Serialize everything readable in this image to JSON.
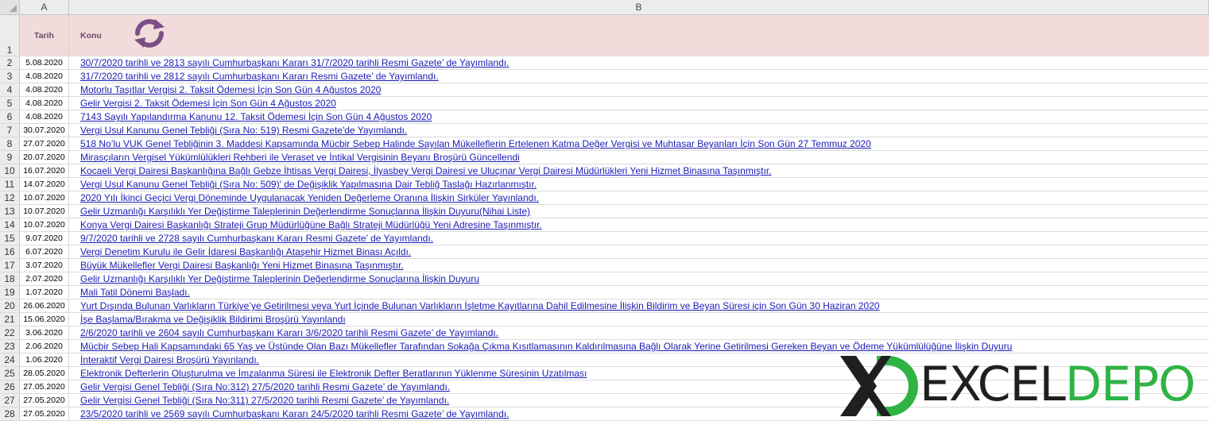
{
  "columns": {
    "a": "A",
    "b": "B"
  },
  "header": {
    "row_num": "1",
    "col_a": "Tarih",
    "col_b": "Konu"
  },
  "icons": {
    "refresh": "refresh-icon",
    "select_all": "select-all-triangle"
  },
  "colors": {
    "header_fill": "#f2dcdb",
    "link": "#1c1cb6",
    "refresh_icon": "#7b4e86",
    "logo_green": "#2fb344"
  },
  "logo": {
    "part1": "EXCEL",
    "part2": "DEPO"
  },
  "rows": [
    {
      "n": "2",
      "date": "5.08.2020",
      "title": "30/7/2020 tarihli ve 2813 sayılı Cumhurbaşkanı Kararı 31/7/2020 tarihli Resmi Gazete’ de Yayımlandı."
    },
    {
      "n": "3",
      "date": "4.08.2020",
      "title": "31/7/2020 tarihli ve 2812 sayılı Cumhurbaşkanı Kararı Resmi Gazete’ de Yayımlandı."
    },
    {
      "n": "4",
      "date": "4.08.2020",
      "title": "Motorlu Taşıtlar Vergisi 2. Taksit Ödemesi İçin Son Gün 4 Ağustos 2020"
    },
    {
      "n": "5",
      "date": "4.08.2020",
      "title": "Gelir Vergisi 2. Taksit Ödemesi İçin Son Gün 4 Ağustos 2020"
    },
    {
      "n": "6",
      "date": "4.08.2020",
      "title": "7143 Sayılı Yapılandırma Kanunu 12. Taksit Ödemesi İçin Son Gün 4 Ağustos 2020"
    },
    {
      "n": "7",
      "date": "30.07.2020",
      "title": "Vergi Usul Kanunu Genel Tebliği (Sıra No: 519) Resmi Gazete'de Yayımlandı."
    },
    {
      "n": "8",
      "date": "27.07.2020",
      "title": "518 No’lu VUK Genel Tebliğinin 3. Maddesi Kapsamında Mücbir Sebep Halinde Sayılan Mükelleflerin Ertelenen Katma Değer Vergisi ve Muhtasar Beyanları İçin Son Gün 27 Temmuz 2020"
    },
    {
      "n": "9",
      "date": "20.07.2020",
      "title": "Mirasçıların Vergisel Yükümlülükleri Rehberi ile Veraset ve İntikal Vergisinin Beyanı Broşürü Güncellendi"
    },
    {
      "n": "10",
      "date": "16.07.2020",
      "title": "Kocaeli Vergi Dairesi Başkanlığına Bağlı Gebze İhtisas Vergi Dairesi, İlyasbey Vergi Dairesi ve Uluçınar Vergi Dairesi Müdürlükleri Yeni Hizmet Binasına Taşınmıştır."
    },
    {
      "n": "11",
      "date": "14.07.2020",
      "title": "Vergi Usul Kanunu Genel Tebliği (Sıra No: 509)' de Değişiklik Yapılmasına Dair Tebliğ Taslağı Hazırlanmıştır."
    },
    {
      "n": "12",
      "date": "10.07.2020",
      "title": "2020 Yılı İkinci Geçici Vergi Döneminde Uygulanacak Yeniden Değerleme Oranına İlişkin Sirküler Yayınlandı."
    },
    {
      "n": "13",
      "date": "10.07.2020",
      "title": "Gelir Uzmanlığı Karşılıklı Yer Değiştirme Taleplerinin Değerlendirme Sonuçlarına İlişkin Duyuru(Nihai Liste)"
    },
    {
      "n": "14",
      "date": "10.07.2020",
      "title": "Konya Vergi Dairesi Başkanlığı Strateji Grup Müdürlüğüne Bağlı Strateji Müdürlüğü Yeni Adresine Taşınmıştır."
    },
    {
      "n": "15",
      "date": "9.07.2020",
      "title": "9/7/2020 tarihli ve 2728 sayılı Cumhurbaşkanı Kararı Resmi Gazete’ de Yayımlandı."
    },
    {
      "n": "16",
      "date": "6.07.2020",
      "title": "Vergi Denetim Kurulu ile Gelir İdaresi Başkanlığı Ataşehir Hizmet Binası Açıldı."
    },
    {
      "n": "17",
      "date": "3.07.2020",
      "title": "Büyük Mükellefler Vergi Dairesi Başkanlığı Yeni Hizmet Binasına Taşınmıştır."
    },
    {
      "n": "18",
      "date": "2.07.2020",
      "title": "Gelir Uzmanlığı Karşılıklı Yer Değiştirme Taleplerinin Değerlendirme Sonuçlarına İlişkin Duyuru"
    },
    {
      "n": "19",
      "date": "1.07.2020",
      "title": "Mali Tatil Dönemi Başladı."
    },
    {
      "n": "20",
      "date": "26.06.2020",
      "title": "Yurt Dışında Bulunan Varlıkların Türkiye’ye Getirilmesi veya Yurt İçinde Bulunan Varlıkların İşletme Kayıtlarına Dahil Edilmesine İlişkin Bildirim ve Beyan Süresi için Son Gün 30 Haziran 2020"
    },
    {
      "n": "21",
      "date": "15.06.2020",
      "title": "İşe Başlama/Bırakma ve Değişiklik Bildirimi Broşürü Yayınlandı"
    },
    {
      "n": "22",
      "date": "3.06.2020",
      "title": "2/6/2020 tarihli ve 2604 sayılı Cumhurbaşkanı Kararı 3/6/2020 tarihli Resmi Gazete’ de Yayımlandı."
    },
    {
      "n": "23",
      "date": "2.06.2020",
      "title": "Mücbir Sebep Hali Kapsamındaki 65 Yaş ve Üstünde Olan Bazı Mükellefler Tarafından Sokağa Çıkma Kısıtlamasının Kaldırılmasına Bağlı Olarak Yerine Getirilmesi Gereken Beyan ve Ödeme Yükümlülüğüne İlişkin Duyuru"
    },
    {
      "n": "24",
      "date": "1.06.2020",
      "title": "İnteraktif Vergi Dairesi Broşürü Yayınlandı."
    },
    {
      "n": "25",
      "date": "28.05.2020",
      "title": "Elektronik Defterlerin Oluşturulma ve İmzalanma Süresi ile Elektronik Defter Beratlarının Yüklenme Süresinin Uzatılması"
    },
    {
      "n": "26",
      "date": "27.05.2020",
      "title": "Gelir Vergisi Genel Tebliği (Sıra No:312) 27/5/2020 tarihli Resmi Gazete’ de Yayımlandı."
    },
    {
      "n": "27",
      "date": "27.05.2020",
      "title": "Gelir Vergisi Genel Tebliği (Sıra No:311) 27/5/2020 tarihli Resmi Gazete’ de Yayımlandı."
    },
    {
      "n": "28",
      "date": "27.05.2020",
      "title": "23/5/2020 tarihli ve 2569 sayılı Cumhurbaşkanı Kararı 24/5/2020 tarihli Resmi Gazete’ de Yayımlandı."
    }
  ]
}
